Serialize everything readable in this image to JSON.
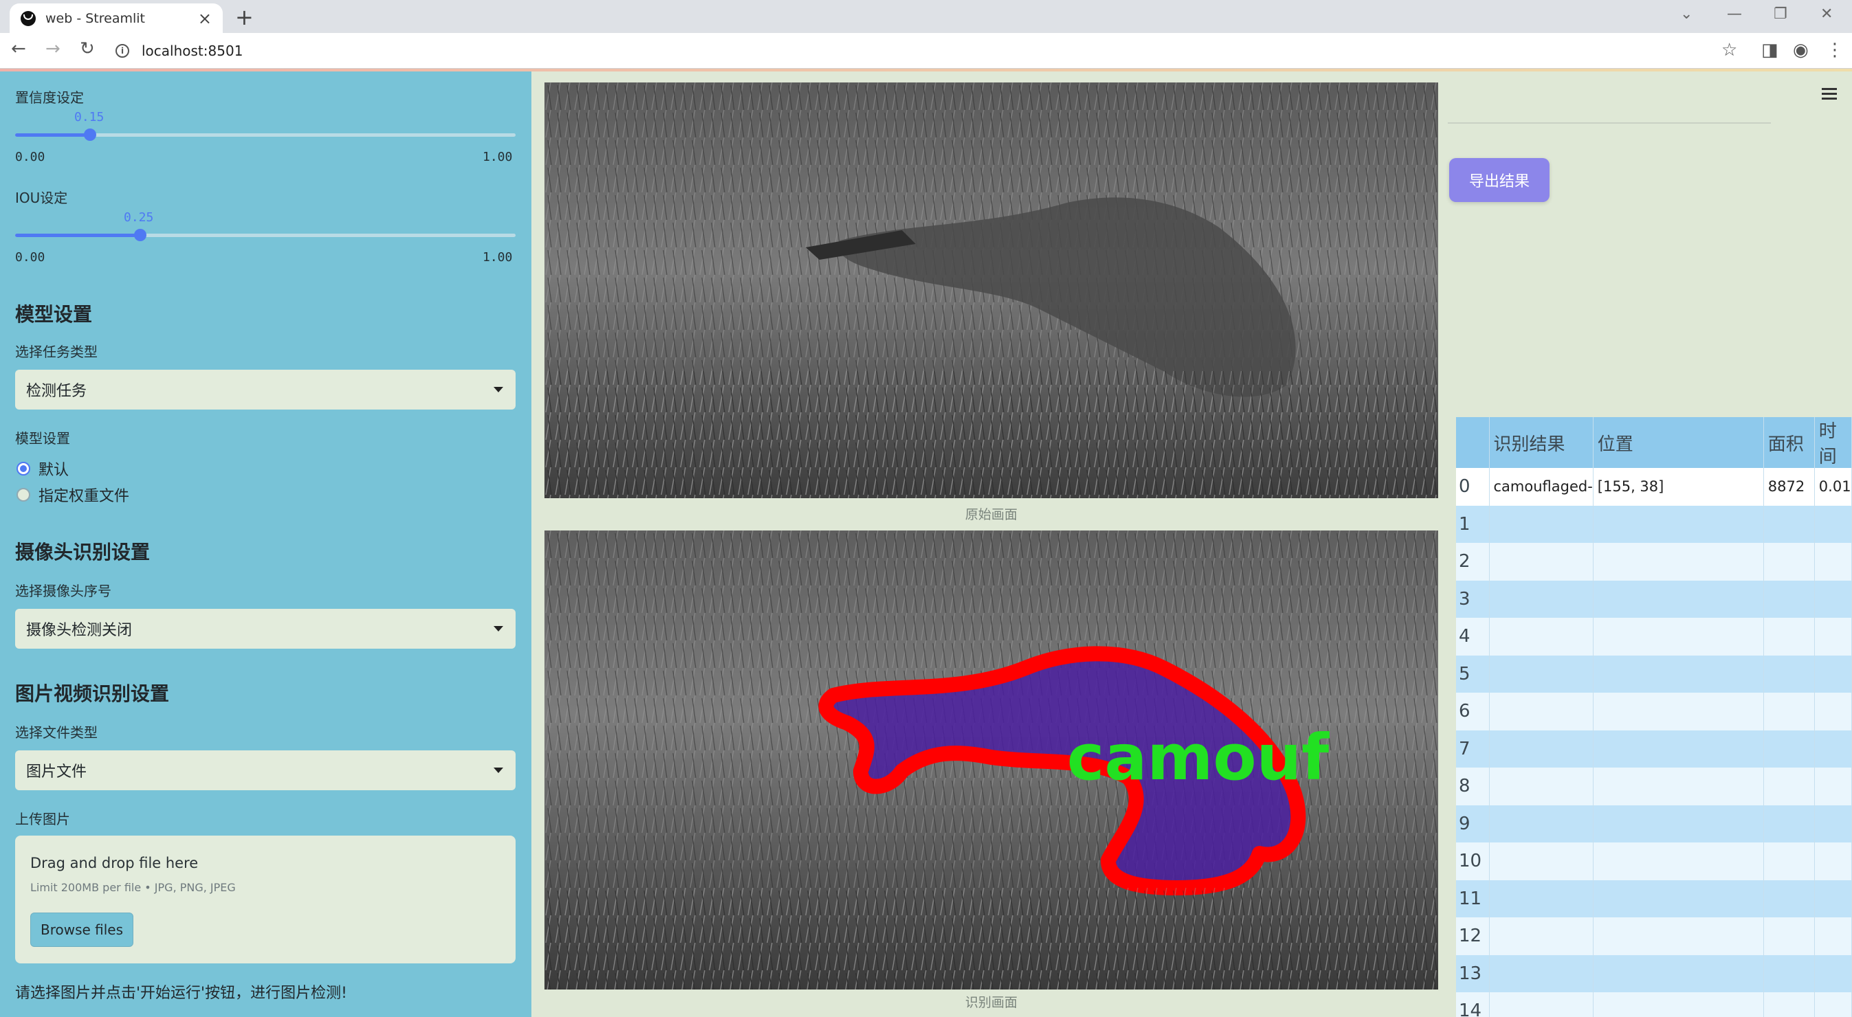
{
  "browser": {
    "tab_title": "web - Streamlit",
    "url": "localhost:8501"
  },
  "sidebar": {
    "confidence": {
      "label": "置信度设定",
      "value": "0.15",
      "value_num": 0.15,
      "min": "0.00",
      "max": "1.00"
    },
    "iou": {
      "label": "IOU设定",
      "value": "0.25",
      "value_num": 0.25,
      "min": "0.00",
      "max": "1.00"
    },
    "model_header": "模型设置",
    "task_type_label": "选择任务类型",
    "task_type_value": "检测任务",
    "model_settings_label": "模型设置",
    "radio_default": "默认",
    "radio_custom": "指定权重文件",
    "camera_header": "摄像头识别设置",
    "camera_select_label": "选择摄像头序号",
    "camera_select_value": "摄像头检测关闭",
    "media_header": "图片视频识别设置",
    "file_type_label": "选择文件类型",
    "file_type_value": "图片文件",
    "upload_label": "上传图片",
    "upload_drop": "Drag and drop file here",
    "upload_limit": "Limit 200MB per file • JPG, PNG, JPEG",
    "browse_button": "Browse files",
    "hint": "请选择图片并点击'开始运行'按钮，进行图片检测!"
  },
  "main": {
    "original_caption": "原始画面",
    "detected_caption": "识别画面",
    "overlay_text": "camouf"
  },
  "right": {
    "export_button": "导出结果",
    "table_headers": [
      "",
      "识别结果",
      "位置",
      "面积",
      "时间"
    ],
    "rows": [
      {
        "idx": "0",
        "result": "camouflaged-",
        "position": "[155, 38]",
        "area": "8872",
        "time": "0.01"
      },
      {
        "idx": "1"
      },
      {
        "idx": "2"
      },
      {
        "idx": "3"
      },
      {
        "idx": "4"
      },
      {
        "idx": "5"
      },
      {
        "idx": "6"
      },
      {
        "idx": "7"
      },
      {
        "idx": "8"
      },
      {
        "idx": "9"
      },
      {
        "idx": "10"
      },
      {
        "idx": "11"
      },
      {
        "idx": "12"
      },
      {
        "idx": "13"
      },
      {
        "idx": "14"
      }
    ]
  },
  "colors": {
    "sidebar_bg": "#78c3d7",
    "accent": "#4f79f3",
    "export_button": "#8c86ea",
    "mask_outline": "#ff0000",
    "mask_fill": "#4b1fa0",
    "label_text": "#22e022"
  }
}
